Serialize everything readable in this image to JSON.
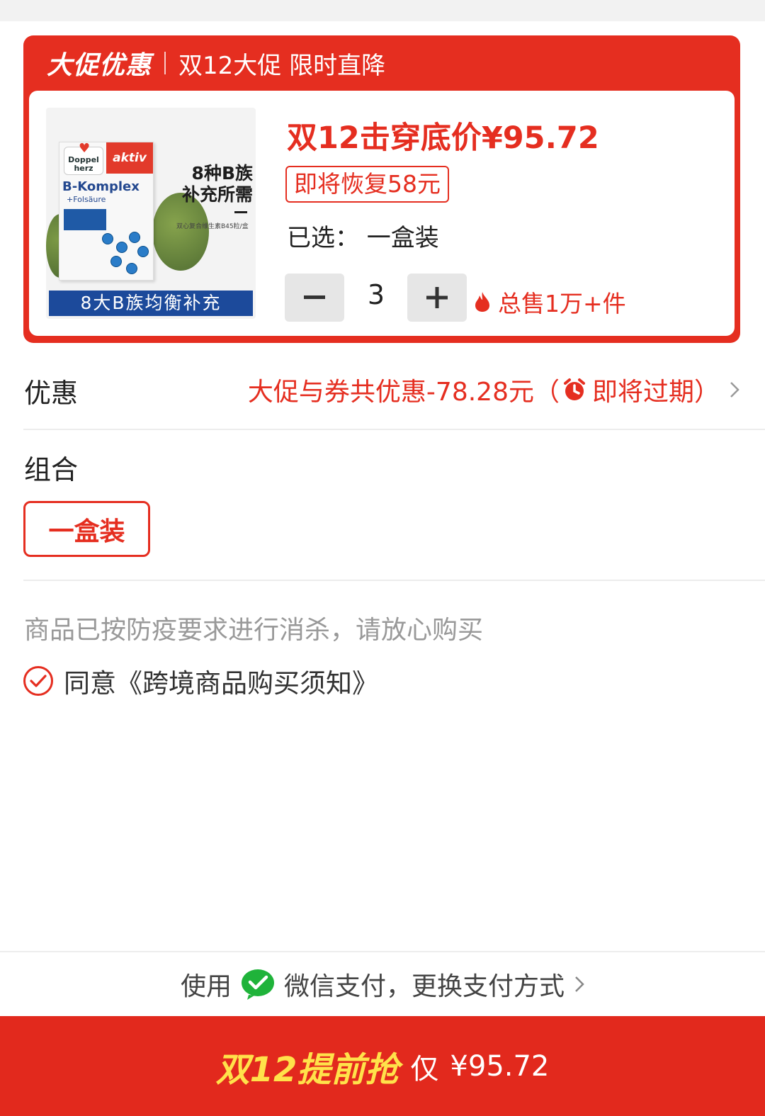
{
  "promo": {
    "brand": "大促优惠",
    "subtitle": "双12大促 限时直降",
    "price_line": "双12击穿底价¥95.72",
    "restore_badge": "即将恢复58元",
    "selected": "已选： 一盒装",
    "quantity": "3",
    "sales": "总售1万+件",
    "product_image": {
      "box_brand": "Doppel herz",
      "box_tag": "aktiv",
      "box_title": "B-Komplex",
      "box_subtitle": "+Folsäure",
      "side_line1": "8种B族",
      "side_line2": "补充所需",
      "side_small": "双心复合维生素B45粒/盒",
      "banner": "8大B族均衡补充"
    }
  },
  "discount": {
    "label": "优惠",
    "value_main": "大促与券共优惠-78.28元（",
    "value_tail": "即将过期）"
  },
  "combo": {
    "label": "组合",
    "options": [
      "一盒装"
    ]
  },
  "notice": "商品已按防疫要求进行消杀，请放心购买",
  "agreement": "同意《跨境商品购买须知》",
  "payment": {
    "prefix": "使用",
    "method": "微信支付，更换支付方式"
  },
  "cta": {
    "main": "双12提前抢",
    "only": "仅",
    "price": "¥95.72"
  },
  "colors": {
    "accent": "#e52e20",
    "cta_text": "#ffe24a"
  }
}
